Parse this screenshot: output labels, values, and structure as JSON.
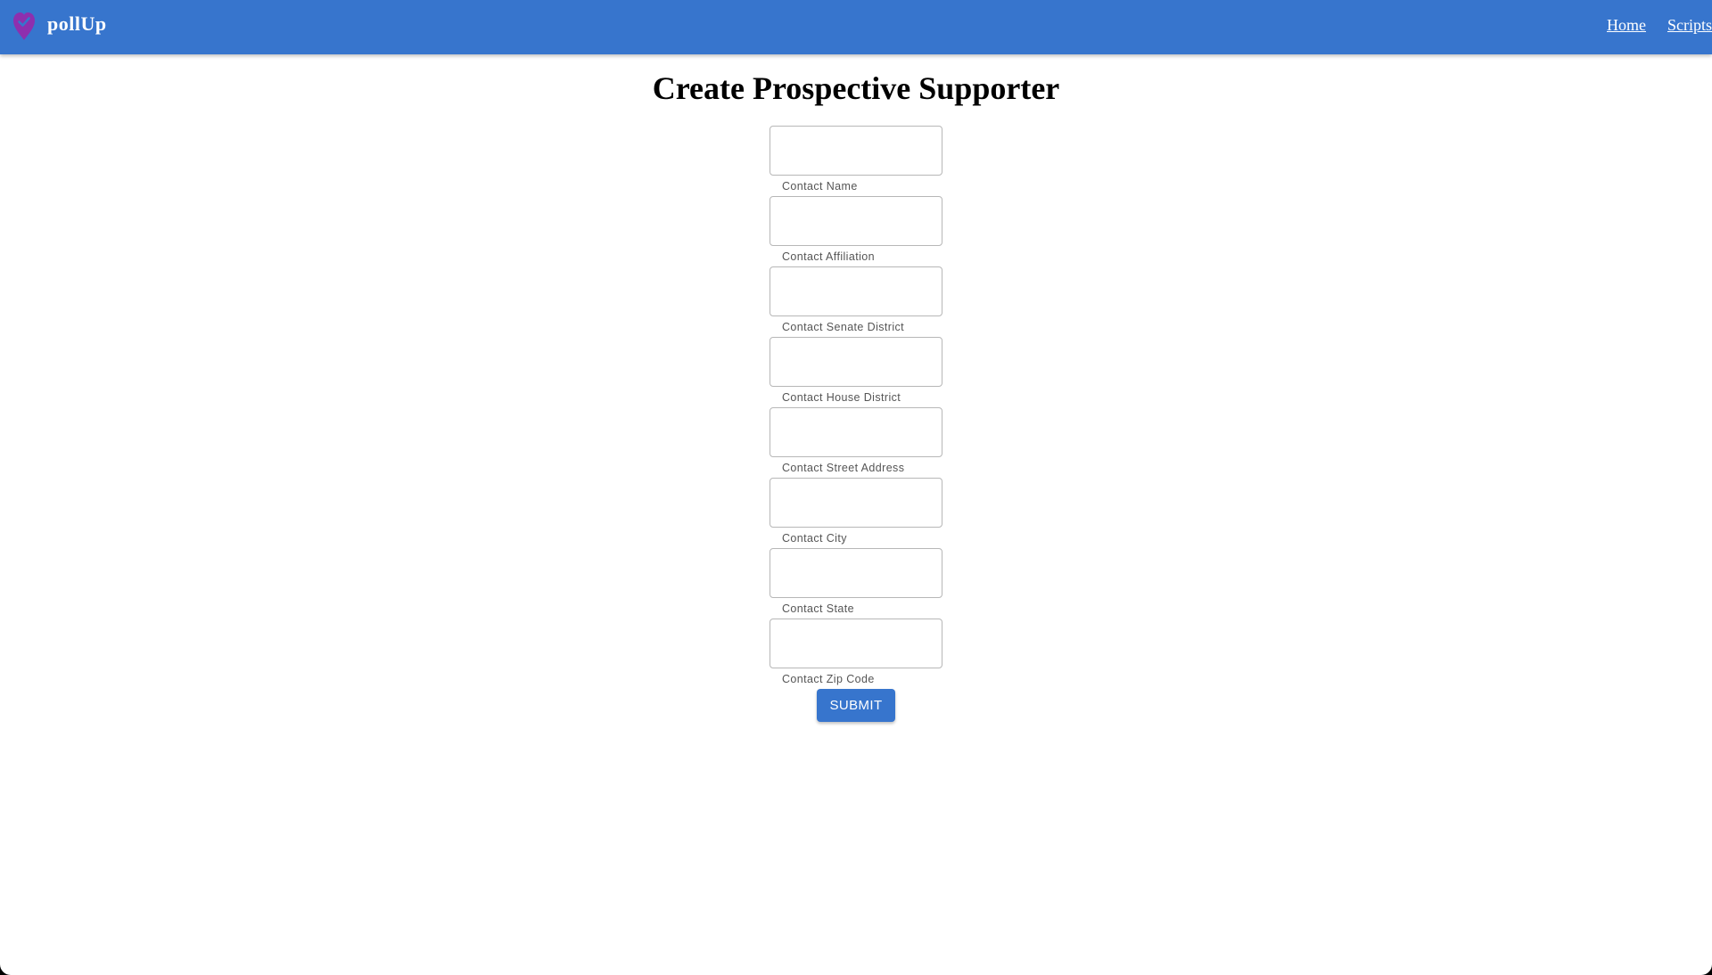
{
  "app": {
    "brand": "pollUp",
    "brand_color": "#3775cd",
    "logo_icon": "heart-checkmark-pin-icon",
    "logo_color": "#8e2fae"
  },
  "nav": {
    "items": [
      {
        "label": "Home"
      },
      {
        "label": "Scripts"
      }
    ]
  },
  "main": {
    "title": "Create Prospective Supporter",
    "fields": [
      {
        "label": "Contact Name",
        "value": ""
      },
      {
        "label": "Contact Affiliation",
        "value": ""
      },
      {
        "label": "Contact Senate District",
        "value": ""
      },
      {
        "label": "Contact House District",
        "value": ""
      },
      {
        "label": "Contact Street Address",
        "value": ""
      },
      {
        "label": "Contact City",
        "value": ""
      },
      {
        "label": "Contact State",
        "value": ""
      },
      {
        "label": "Contact Zip Code",
        "value": ""
      }
    ],
    "submit_label": "SUBMIT"
  }
}
